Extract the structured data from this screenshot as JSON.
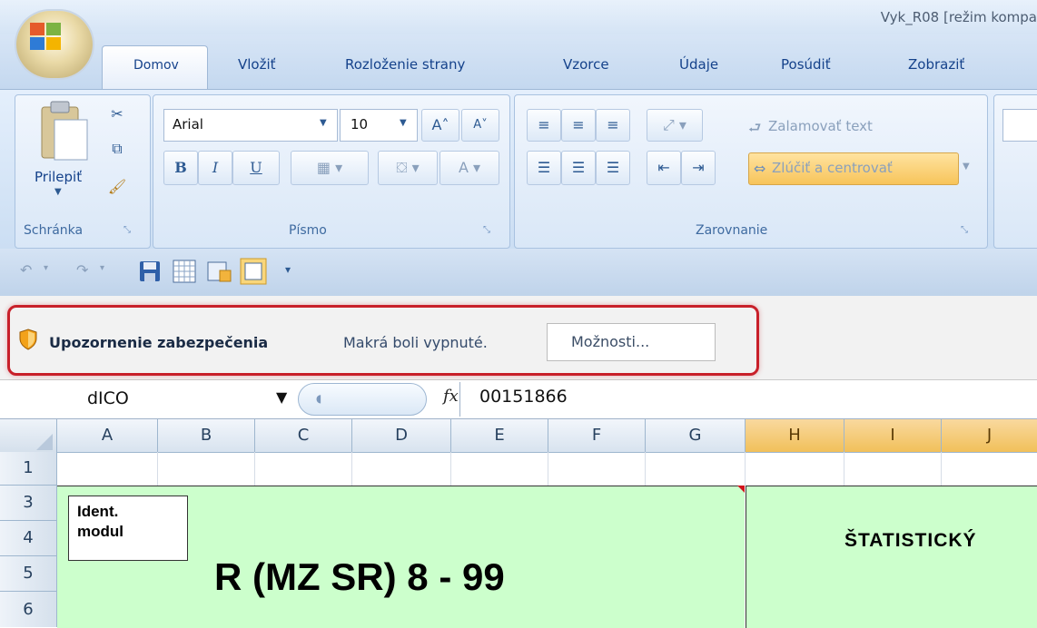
{
  "window": {
    "title": "Vyk_R08  [režim kompa"
  },
  "tabs": [
    "Domov",
    "Vložiť",
    "Rozloženie strany",
    "Vzorce",
    "Údaje",
    "Posúdiť",
    "Zobraziť"
  ],
  "ribbon": {
    "clipboard": {
      "paste_label": "Prilepiť",
      "group_label": "Schránka"
    },
    "font": {
      "family": "Arial",
      "size": "10",
      "group_label": "Písmo",
      "bold": "B",
      "italic": "I",
      "underline": "U",
      "font_color": "A"
    },
    "alignment": {
      "wrap_text": "Zalamovať text",
      "merge_center": "Zlúčiť a centrovať",
      "group_label": "Zarovnanie"
    }
  },
  "security_bar": {
    "title": "Upozornenie zabezpečenia",
    "message": "Makrá boli vypnuté.",
    "options_button": "Možnosti..."
  },
  "formula_bar": {
    "name_box": "dICO",
    "fx": "fx",
    "value": "00151866"
  },
  "grid": {
    "columns": [
      "A",
      "B",
      "C",
      "D",
      "E",
      "F",
      "G",
      "H",
      "I",
      "J"
    ],
    "selected_column": "H",
    "rows": [
      "1",
      "3",
      "4",
      "5",
      "6"
    ],
    "ident_label": "Ident.\nmodul",
    "form_code": "R (MZ SR) 8 - 99",
    "stat_header": "ŠTATISTICKÝ"
  },
  "colors": {
    "accent_red": "#c8202a",
    "cell_green": "#ccffcc",
    "selected_header": "#f1c05a"
  },
  "icons": [
    "office-logo-icon",
    "paste-icon",
    "cut-icon",
    "copy-icon",
    "format-painter-icon",
    "grow-font-icon",
    "shrink-font-icon",
    "border-icon",
    "fill-color-icon",
    "align-top-icon",
    "align-middle-icon",
    "align-bottom-icon",
    "orientation-icon",
    "align-left-icon",
    "align-center-icon",
    "align-right-icon",
    "decrease-indent-icon",
    "increase-indent-icon",
    "wrap-text-icon",
    "merge-icon",
    "undo-icon",
    "redo-icon",
    "save-icon",
    "grid-icon",
    "chart-icon",
    "view-icon",
    "qat-dropdown-icon",
    "shield-icon",
    "dialog-launcher-icon"
  ]
}
